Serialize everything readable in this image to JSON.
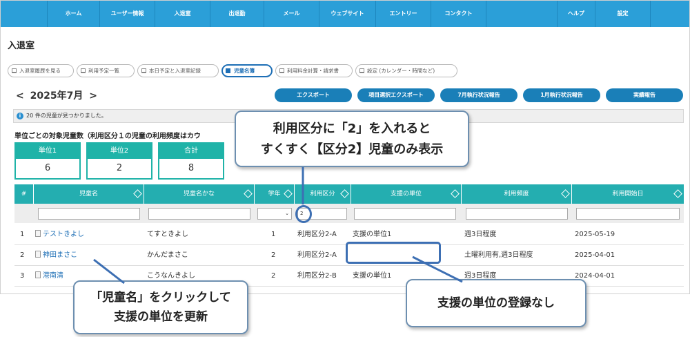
{
  "nav": {
    "items": [
      "ホーム",
      "ユーザー情報",
      "入退室",
      "出退勤",
      "メール",
      "ウェブサイト",
      "エントリー",
      "コンタクト"
    ],
    "right_items": [
      "ヘルプ",
      "設定"
    ]
  },
  "page_title": "入退室",
  "subtabs": [
    "入退室履歴を見る",
    "利用予定一覧",
    "本日予定と入退室記録",
    "児童名簿",
    "利用料金計算・請求書",
    "設定 (カレンダー・時間など)"
  ],
  "active_subtab": "児童名簿",
  "month_nav": {
    "prev": "<",
    "label": "2025年7月",
    "next": ">"
  },
  "actions": [
    "エクスポート",
    "項目選択エクスポート",
    "7月執行状況報告",
    "1月執行状況報告",
    "実績報告"
  ],
  "info_message": "20 件の児童が見つかりました。",
  "info_icon": "i",
  "summary": {
    "title": "単位ごとの対象児童数（利用区分１の児童の利用頻度はカウ",
    "boxes": [
      {
        "label": "単位1",
        "value": "6"
      },
      {
        "label": "単位2",
        "value": "2"
      },
      {
        "label": "合計",
        "value": "8"
      }
    ]
  },
  "table": {
    "headers": [
      "#",
      "児童名",
      "児童名かな",
      "学年",
      "利用区分",
      "支援の単位",
      "利用頻度",
      "利用開始日"
    ],
    "filter_value": "2",
    "rows": [
      {
        "num": "1",
        "name": "テストきよし",
        "kana": "てすときよし",
        "grade": "1",
        "category": "利用区分2-A",
        "unit": "支援の単位1",
        "frequency": "週3日程度",
        "start": "2025-05-19"
      },
      {
        "num": "2",
        "name": "神田まさこ",
        "kana": "かんだまさこ",
        "grade": "2",
        "category": "利用区分2-A",
        "unit": "",
        "frequency": "土曜利用有,週3日程度",
        "start": "2025-04-01"
      },
      {
        "num": "3",
        "name": "港南清",
        "kana": "こうなんきよし",
        "grade": "2",
        "category": "利用区分2-B",
        "unit": "支援の単位1",
        "frequency": "週3日程度",
        "start": "2024-04-01"
      }
    ]
  },
  "annotations": {
    "filter_note": {
      "line1": "利用区分に「2」を入れると",
      "line2": "すくすく【区分2】児童のみ表示"
    },
    "name_note": {
      "line1": "「児童名」をクリックして",
      "line2": "支援の単位を更新"
    },
    "unit_note": {
      "line1": "支援の単位の登録なし"
    }
  },
  "colors": {
    "nav": "#2b9fd8",
    "table_header": "#24aeb0",
    "button": "#1a7fb8",
    "annotation": "#3d6fb3"
  }
}
